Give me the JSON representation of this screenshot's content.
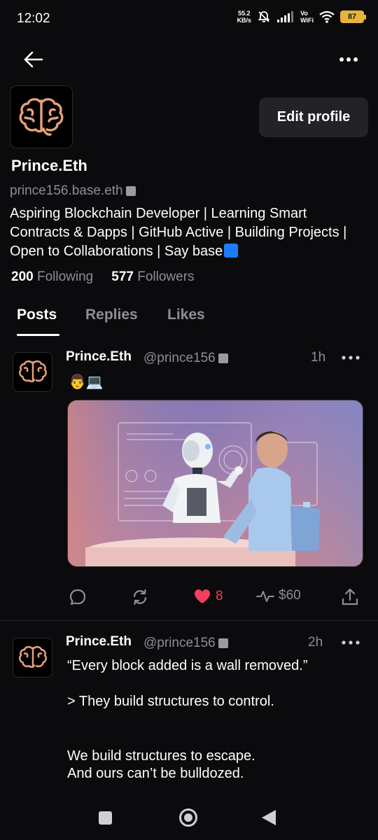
{
  "status_bar": {
    "time": "12:02",
    "net_speed_value": "55.2",
    "net_speed_unit": "KB/s",
    "vowifi_top": "Vo",
    "vowifi_bottom": "WiFi",
    "battery": "87",
    "battery_color": "#e7b43b"
  },
  "profile": {
    "display_name": "Prince.Eth",
    "handle": "prince156.base.eth",
    "bio": "Aspiring Blockchain Developer | Learning Smart Contracts & Dapps | GitHub Active | Building Projects | Open to Collaborations | Say base",
    "edit_button": "Edit profile",
    "following_count": "200",
    "following_label": "Following",
    "followers_count": "577",
    "followers_label": "Followers"
  },
  "tabs": [
    {
      "label": "Posts",
      "active": true
    },
    {
      "label": "Replies",
      "active": false
    },
    {
      "label": "Likes",
      "active": false
    }
  ],
  "posts": [
    {
      "author": "Prince.Eth",
      "handle": "@prince156",
      "time": "1h",
      "text": "👨💻",
      "has_image": true,
      "likes": "8",
      "tip_amount": "$60"
    },
    {
      "author": "Prince.Eth",
      "handle": "@prince156",
      "time": "2h",
      "lines": [
        "“Every block added is a wall removed.”",
        "> They build structures to control.",
        "We build structures to escape.",
        "And ours can’t be bulldozed."
      ]
    }
  ],
  "colors": {
    "background": "#0b0b0d",
    "muted_text": "#8e8e96",
    "like_red": "#f43f5e",
    "button_bg": "#232327"
  },
  "icons": [
    "back-arrow-icon",
    "more-horizontal-icon",
    "brain-icon",
    "comment-icon",
    "repost-icon",
    "heart-icon",
    "activity-icon",
    "share-icon"
  ]
}
